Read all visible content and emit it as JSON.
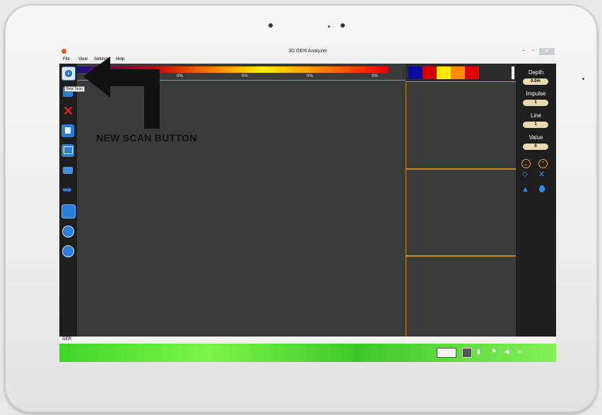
{
  "window": {
    "title": "3D GER Analyzer",
    "minimize": "–",
    "maximize": "▫",
    "close": "✕"
  },
  "menu": [
    "File",
    "View",
    "Settings",
    "Help"
  ],
  "tooltip": "New Scan",
  "scale": {
    "labels": [
      "0%",
      "0%",
      "0%",
      "0%"
    ]
  },
  "colors": {
    "accent": "#c88a1a",
    "swatches": [
      "#0a0aa0",
      "#d40000",
      "#ffe800",
      "#ff8c00",
      "#e00000"
    ]
  },
  "right_panel": {
    "depth_label": "Depth",
    "depth_value": "0.0m",
    "impulse_label": "Impulse",
    "impulse_value": "1",
    "line_label": "Line",
    "line_value": "1",
    "value_label": "Value",
    "value_value": "0"
  },
  "toolbar_icons": [
    "new-scan-icon",
    "open-icon",
    "delete-icon",
    "save-icon",
    "export-icon",
    "print-icon",
    "undo-icon",
    "grid-icon",
    "zoom-in-icon",
    "zoom-out-icon"
  ],
  "status": "GER",
  "annotation": "NEW SCAN BUTTON"
}
